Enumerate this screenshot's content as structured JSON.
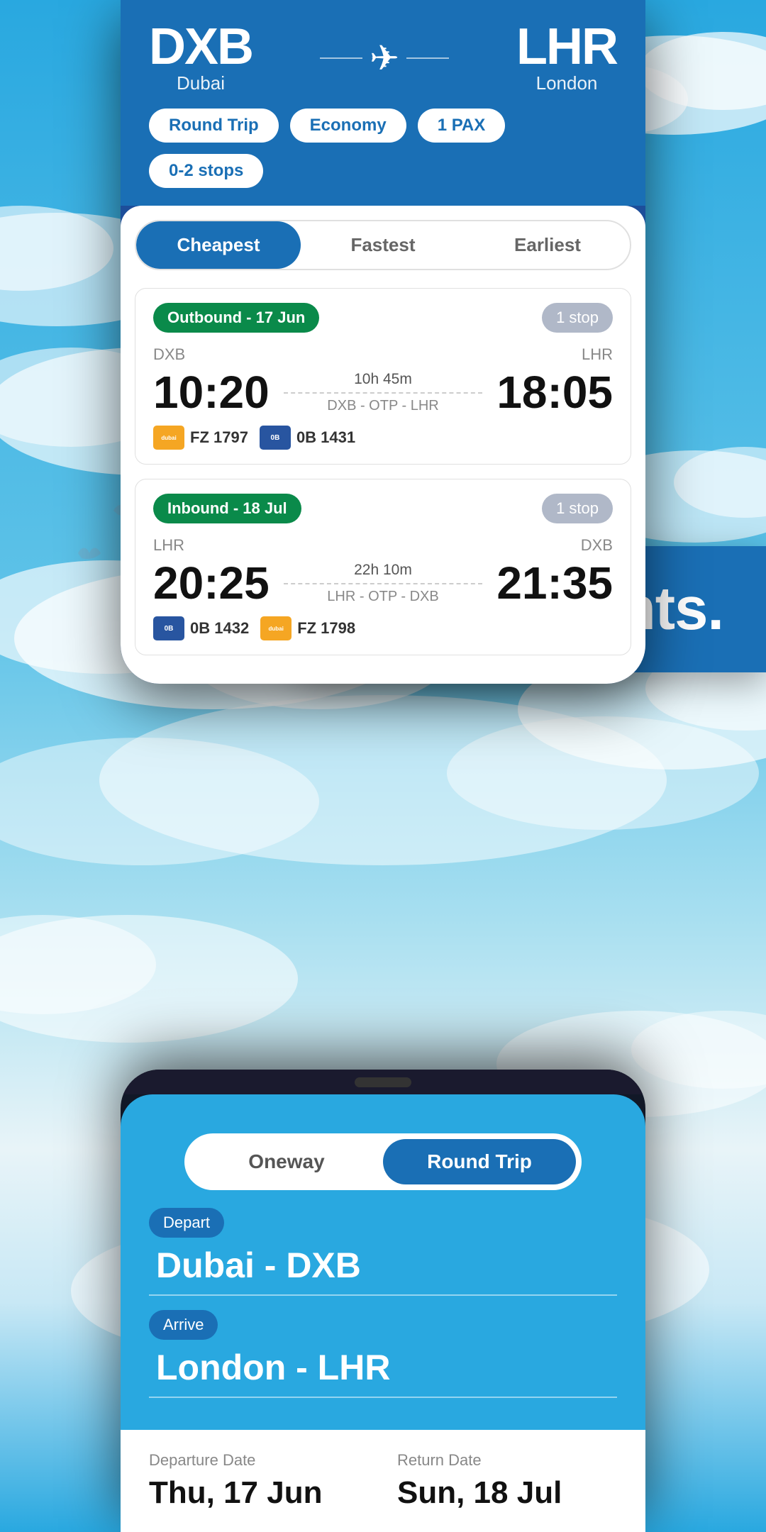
{
  "app": {
    "promo_text": "cheap flights."
  },
  "top_phone": {
    "origin_code": "DXB",
    "origin_name": "Dubai",
    "dest_code": "LHR",
    "dest_name": "London",
    "chips": [
      {
        "label": "Round Trip",
        "key": "round_trip"
      },
      {
        "label": "Economy",
        "key": "economy"
      },
      {
        "label": "1 PAX",
        "key": "pax"
      },
      {
        "label": "0-2 stops",
        "key": "stops"
      }
    ],
    "tabs": [
      {
        "label": "Cheapest",
        "active": true
      },
      {
        "label": "Fastest",
        "active": false
      },
      {
        "label": "Earliest",
        "active": false
      }
    ],
    "outbound": {
      "badge": "Outbound - 17 Jun",
      "stop_badge": "1 stop",
      "origin": "DXB",
      "dest": "LHR",
      "depart_time": "10:20",
      "arrive_time": "18:05",
      "duration": "10h 45m",
      "route": "DXB - OTP - LHR",
      "airlines": [
        {
          "code": "FZ 1797",
          "color": "orange",
          "short": "dubai"
        },
        {
          "code": "0B 1431",
          "color": "blue",
          "short": "0B"
        }
      ]
    },
    "inbound": {
      "badge": "Inbound - 18 Jul",
      "stop_badge": "1 stop",
      "origin": "LHR",
      "dest": "DXB",
      "depart_time": "20:25",
      "arrive_time": "21:35",
      "duration": "22h 10m",
      "route": "LHR - OTP - DXB",
      "airlines": [
        {
          "code": "0B 1432",
          "color": "blue",
          "short": "0B"
        },
        {
          "code": "FZ 1798",
          "color": "orange",
          "short": "dubai"
        }
      ]
    }
  },
  "bottom_phone": {
    "trip_options": [
      {
        "label": "Oneway",
        "active": false
      },
      {
        "label": "Round Trip",
        "active": true
      }
    ],
    "depart_label": "Depart",
    "depart_value": "Dubai - DXB",
    "arrive_label": "Arrive",
    "arrive_value": "London - LHR",
    "departure_date_label": "Departure Date",
    "departure_date_value": "Thu, 17 Jun",
    "return_date_label": "Return Date",
    "return_date_value": "Sun, 18 Jul"
  }
}
